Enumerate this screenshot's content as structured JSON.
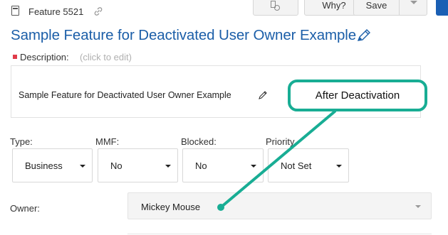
{
  "header": {
    "feature_id": "Feature 5521",
    "icons": [
      "document-icon",
      "link-icon",
      "tree-icon"
    ],
    "buttons": {
      "why_label": "Why?",
      "save_label": "Save"
    }
  },
  "title": "Sample Feature for Deactivated User Owner Example",
  "description": {
    "label": "Description:",
    "hint": "(click to edit)",
    "text": "Sample Feature for Deactivated User Owner Example"
  },
  "fields": {
    "type": {
      "label": "Type:",
      "value": "Business"
    },
    "mmf": {
      "label": "MMF:",
      "value": "No"
    },
    "blocked": {
      "label": "Blocked:",
      "value": "No"
    },
    "priority": {
      "label": "Priority",
      "value": "Not Set"
    }
  },
  "owner": {
    "label": "Owner:",
    "value": "Mickey Mouse"
  },
  "annotation": {
    "text": "After Deactivation",
    "color": "#18ad94"
  },
  "colors": {
    "title": "#1b5ea8",
    "required": "#e03c4a",
    "primary": "#1a5fb4"
  }
}
